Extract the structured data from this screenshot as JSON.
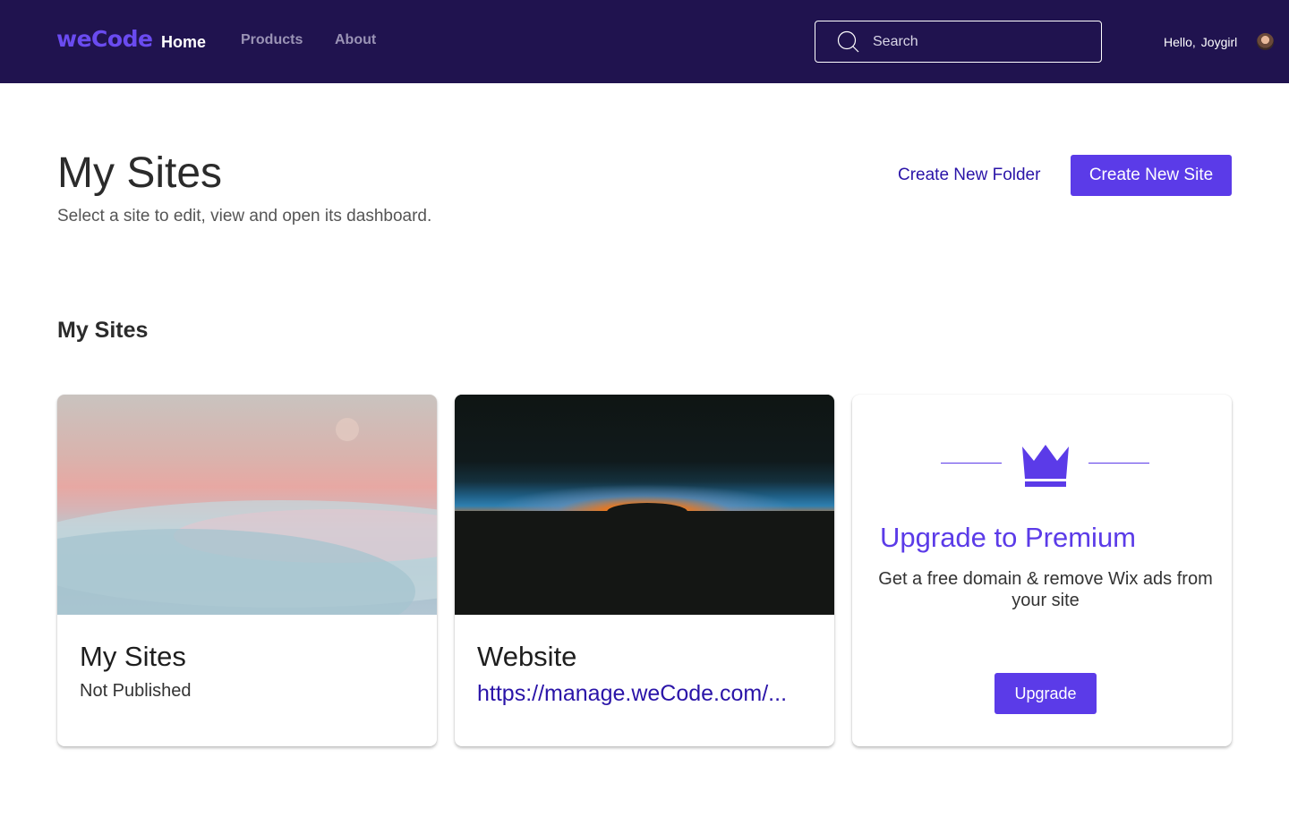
{
  "nav": {
    "logo": "weCode",
    "links": [
      "Home",
      "Products",
      "About"
    ],
    "search_placeholder": "Search",
    "greeting_prefix": "Hello,",
    "user_name": "Joygirl"
  },
  "header": {
    "title": "My Sites",
    "subtitle": "Select a site to edit, view and open its dashboard.",
    "create_folder_label": "Create New Folder",
    "create_site_label": "Create New Site"
  },
  "section": {
    "title": "My Sites"
  },
  "sites": [
    {
      "name": "My Sites",
      "status": "Not Published"
    },
    {
      "name": "Website",
      "url": "https://manage.weCode.com/..."
    }
  ],
  "premium": {
    "title": "Upgrade to Premium",
    "description": "Get a free domain & remove Wix ads from your site",
    "button_label": "Upgrade",
    "icon": "crown-icon"
  },
  "colors": {
    "nav_bg": "#20134f",
    "accent": "#5b3be8",
    "link": "#2a14a8"
  }
}
